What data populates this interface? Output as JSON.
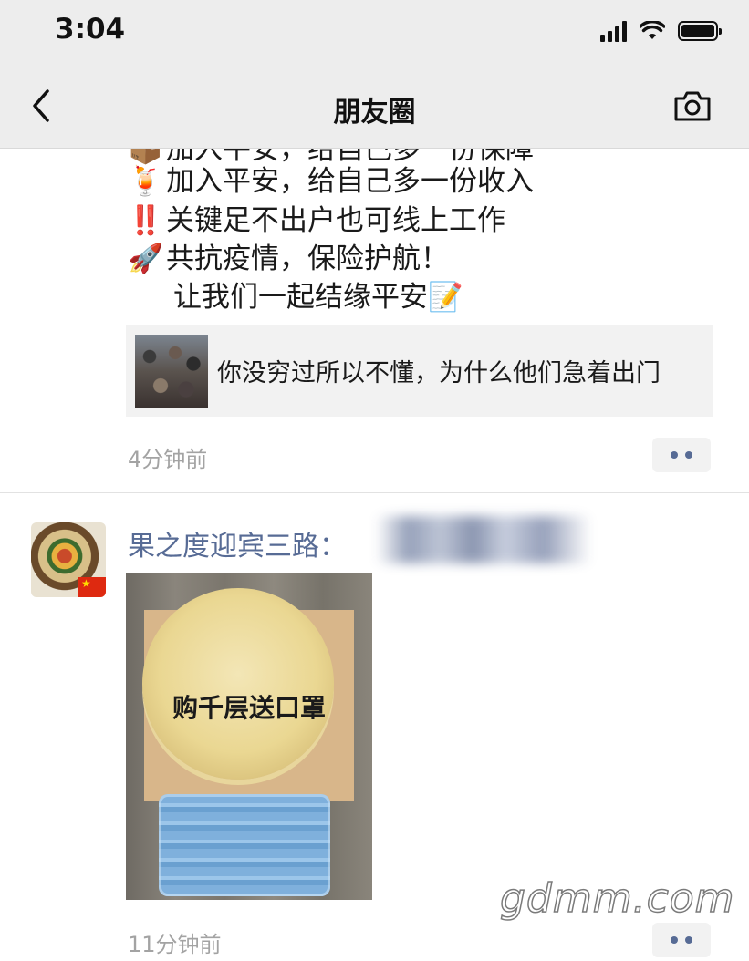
{
  "status_bar": {
    "time": "3:04"
  },
  "nav": {
    "title": "朋友圈"
  },
  "post1": {
    "lines": [
      {
        "emoji": "📦",
        "text": "加入平安，给自己多一份保障"
      },
      {
        "emoji": "🍹",
        "text": "加入平安，给自己多一份收入"
      },
      {
        "emoji": "‼️",
        "text": "关键足不出户也可线上工作"
      },
      {
        "emoji": "🚀",
        "text": "共抗疫情，保险护航！"
      },
      {
        "emoji": "",
        "text": "让我们一起结缘平安📝"
      }
    ],
    "link_title": "你没穷过所以不懂，为什么他们急着出门",
    "time": "4分钟前"
  },
  "post2": {
    "author": "果之度迎宾三路：",
    "image_caption": "购千层送口罩",
    "time": "11分钟前"
  },
  "watermark": "gdmm.com",
  "colors": {
    "link": "#576b95",
    "header_bg": "#ededed",
    "card_bg": "#f2f2f2",
    "meta": "#a3a3a3"
  }
}
